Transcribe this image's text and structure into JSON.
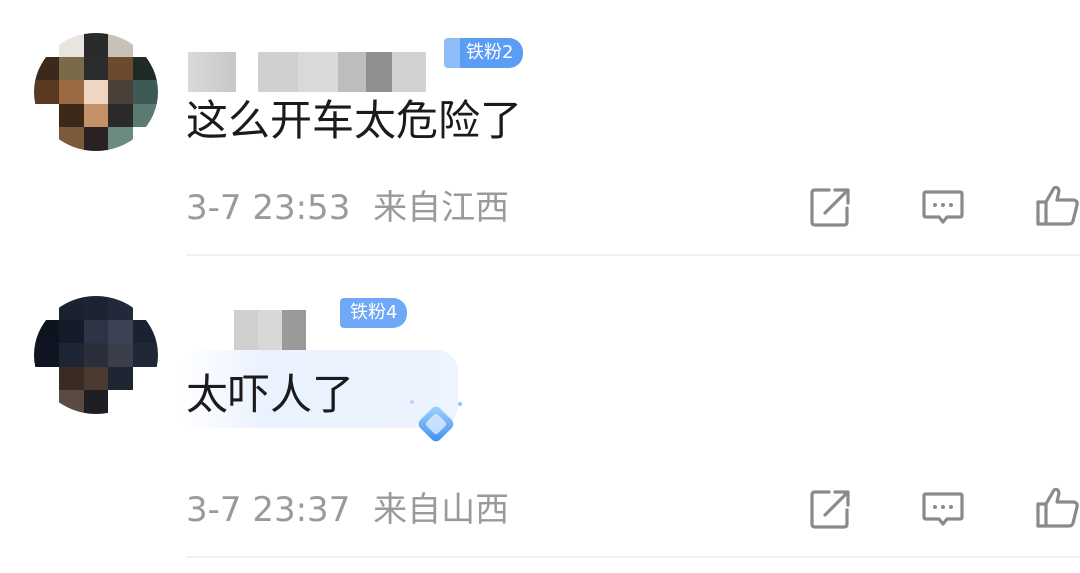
{
  "comments": [
    {
      "badge": "铁粉2",
      "text": "这么开车太危险了",
      "time": "3-7 23:53",
      "location": "来自江西"
    },
    {
      "badge": "铁粉4",
      "text": "太吓人了",
      "time": "3-7 23:37",
      "location": "来自山西"
    }
  ],
  "icons": {
    "repost": "share-icon",
    "reply": "comment-icon",
    "like": "thumbs-up-icon"
  },
  "colors": {
    "badge": "#5b9cf5",
    "meta_text": "#9a9a9a",
    "icon": "#8a8a8a"
  }
}
